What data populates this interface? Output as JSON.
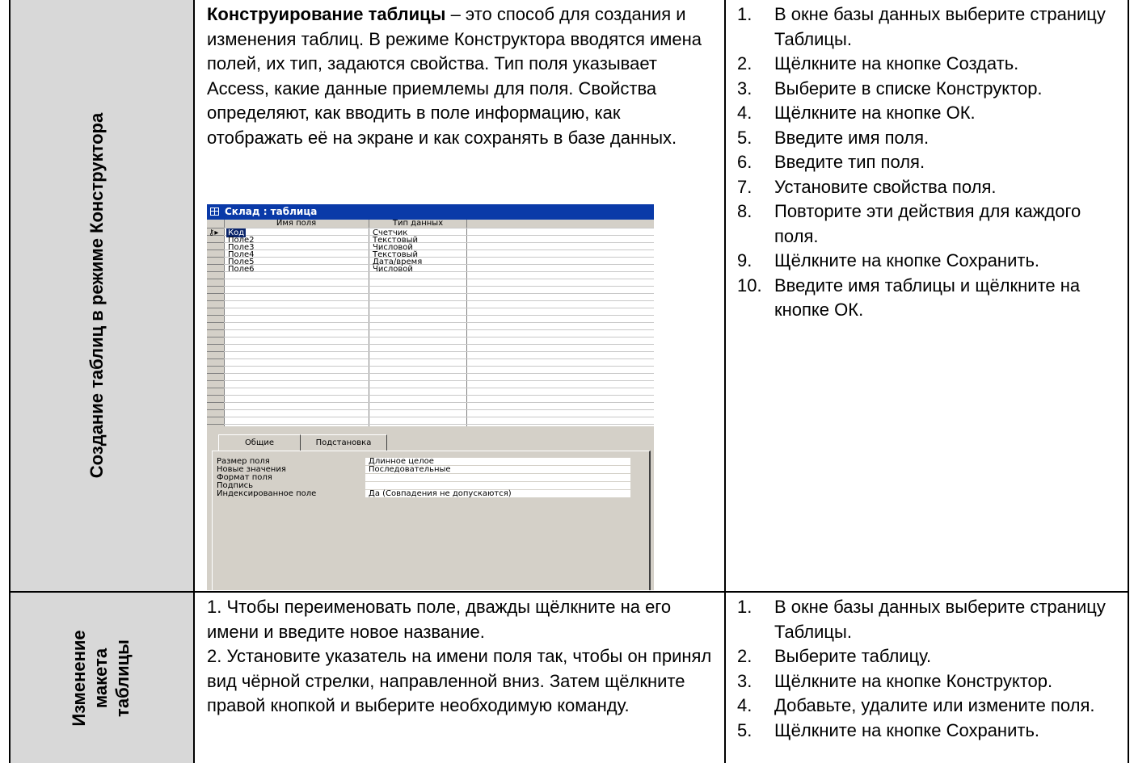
{
  "rows": [
    {
      "vertical_label": "Создание таблиц в режиме Конструктора",
      "description_bold": "Конструирование таблицы",
      "description_rest": " – это способ для создания и изменения таблиц. В режиме Конструктора вводятся имена полей, их тип, задаются свойства. Тип поля указывает Access, какие данные приемлемы для поля.  Свойства определяют, как вводить в поле информацию, как отображать её на экране и как сохранять в базе данных.",
      "steps": [
        {
          "num": "1.",
          "text": "В окне базы данных выберите страницу Таблицы."
        },
        {
          "num": "2.",
          "text": "Щёлкните на кнопке Создать."
        },
        {
          "num": "3.",
          "text": "Выберите в списке Конструктор."
        },
        {
          "num": "4.",
          "text": "Щёлкните на кнопке ОК."
        },
        {
          "num": "5.",
          "text": "Введите имя поля."
        },
        {
          "num": "6.",
          "text": "Введите тип поля."
        },
        {
          "num": "7.",
          "text": "Установите свойства поля."
        },
        {
          "num": "8.",
          "text": "Повторите эти действия для каждого поля."
        },
        {
          "num": "9.",
          "text": "Щёлкните на кнопке Сохранить."
        },
        {
          "num": "10.",
          "text": "Введите имя таблицы и щёлкните на кнопке ОК."
        }
      ]
    },
    {
      "vertical_label_lines": [
        "Изменение",
        "макета",
        "таблицы"
      ],
      "paragraphs": [
        "1. Чтобы переименовать поле, дважды щёлкните на его имени и введите новое название.",
        "2. Установите указатель на имени поля так, чтобы он принял вид чёрной стрелки, направленной вниз. Затем щёлкните правой кнопкой и выберите необходимую команду."
      ],
      "steps": [
        {
          "num": "1.",
          "text": "В окне базы данных выберите страницу Таблицы."
        },
        {
          "num": "2.",
          "text": "Выберите таблицу."
        },
        {
          "num": "3.",
          "text": "Щёлкните на кнопке Конструктор."
        },
        {
          "num": "4.",
          "text": "Добавьте, удалите или измените поля."
        },
        {
          "num": "5.",
          "text": "Щёлкните на кнопке Сохранить."
        }
      ]
    }
  ],
  "designer": {
    "title": "Склад : таблица",
    "col_field": "Имя поля",
    "col_type": "Тип данных",
    "fields": [
      {
        "name": "Код",
        "type": "Счетчик"
      },
      {
        "name": "Поле2",
        "type": "Текстовый"
      },
      {
        "name": "Поле3",
        "type": "Числовой"
      },
      {
        "name": "Поле4",
        "type": "Текстовый"
      },
      {
        "name": "Поле5",
        "type": "Дата/время"
      },
      {
        "name": "Поле6",
        "type": "Числовой"
      }
    ],
    "tabs": [
      "Общие",
      "Подстановка"
    ],
    "properties": [
      {
        "label": "Размер поля",
        "value": "Длинное целое"
      },
      {
        "label": "Новые значения",
        "value": "Последовательные"
      },
      {
        "label": "Формат поля",
        "value": ""
      },
      {
        "label": "Подпись",
        "value": ""
      },
      {
        "label": "Индексированное поле",
        "value": "Да (Совпадения не допускаются)"
      }
    ]
  },
  "colors": {
    "label_column": "#d8d8d8",
    "titlebar": "#0a3aa8",
    "window_bg": "#d4d0c8"
  }
}
